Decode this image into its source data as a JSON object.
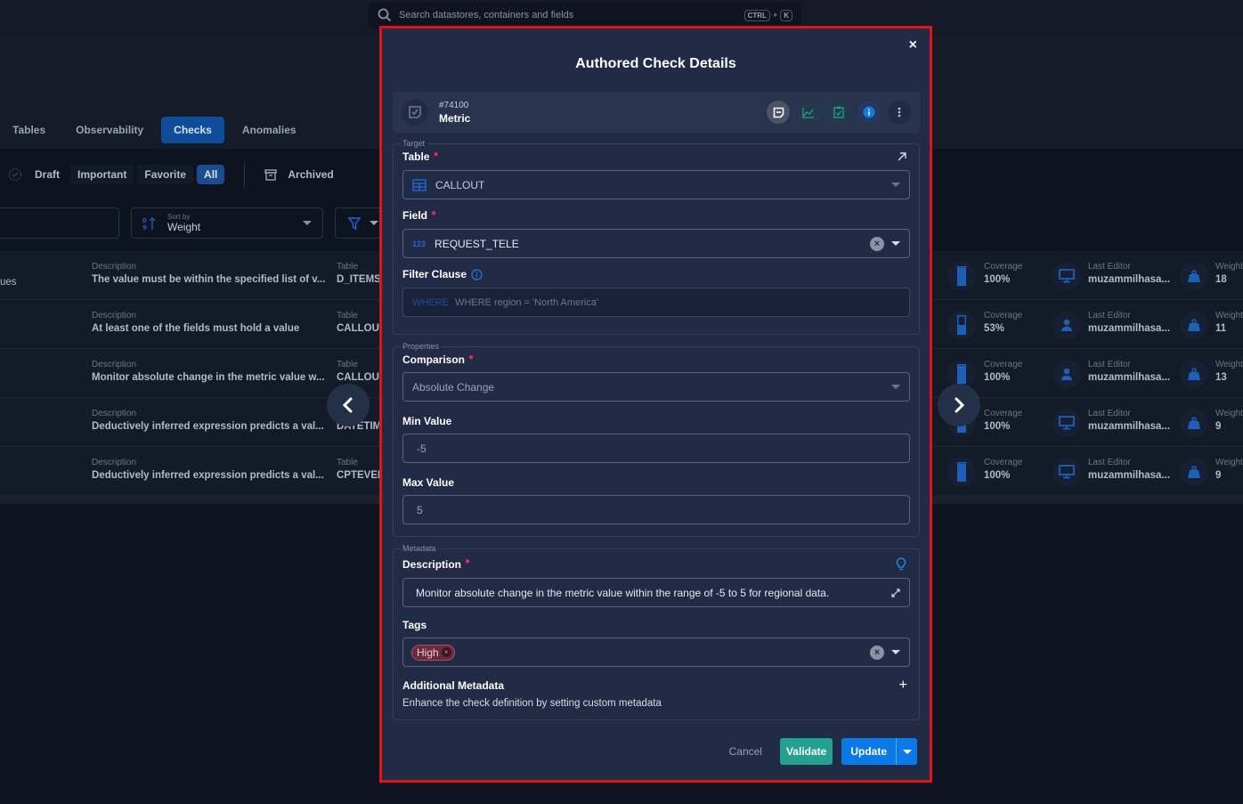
{
  "global_search": {
    "placeholder": "Search datastores, containers and fields",
    "shortcut_key1": "CTRL",
    "shortcut_plus": "+",
    "shortcut_key2": "K"
  },
  "tabs": [
    {
      "label": "Tables",
      "active": false
    },
    {
      "label": "Observability",
      "active": false
    },
    {
      "label": "Checks",
      "active": true
    },
    {
      "label": "Anomalies",
      "active": false
    }
  ],
  "filters": {
    "chips": [
      "Draft",
      "Important",
      "Favorite",
      "All"
    ],
    "active_chip": "All",
    "archived_label": "Archived"
  },
  "sort": {
    "label": "Sort by",
    "value": "Weight"
  },
  "list": {
    "partial_name": "ues",
    "rows": [
      {
        "desc_label": "Description",
        "description": "The value must be within the specified list of v...",
        "table_label": "Table",
        "table": "D_ITEMS",
        "coverage_label": "Coverage",
        "coverage": "100%",
        "editor_label": "Last Editor",
        "editor": "muzammilhasa...",
        "editor_icon": "monitor-icon",
        "weight_label": "Weight",
        "weight": "18"
      },
      {
        "desc_label": "Description",
        "description": "At least one of the fields must hold a value",
        "table_label": "Table",
        "table": "CALLOUT",
        "coverage_label": "Coverage",
        "coverage": "53%",
        "editor_label": "Last Editor",
        "editor": "muzammilhasa...",
        "editor_icon": "user-icon",
        "weight_label": "Weight",
        "weight": "11"
      },
      {
        "desc_label": "Description",
        "description": "Monitor absolute change in the metric value w...",
        "table_label": "Table",
        "table": "CALLOUT",
        "coverage_label": "Coverage",
        "coverage": "100%",
        "editor_label": "Last Editor",
        "editor": "muzammilhasa...",
        "editor_icon": "user-icon",
        "weight_label": "Weight",
        "weight": "13"
      },
      {
        "desc_label": "Description",
        "description": "Deductively inferred expression predicts a val...",
        "table_label": "Table",
        "table": "DATETIME",
        "coverage_label": "Coverage",
        "coverage": "100%",
        "editor_label": "Last Editor",
        "editor": "muzammilhasa...",
        "editor_icon": "monitor-icon",
        "weight_label": "Weight",
        "weight": "9"
      },
      {
        "desc_label": "Description",
        "description": "Deductively inferred expression predicts a val...",
        "table_label": "Table",
        "table": "CPTEVENTS",
        "coverage_label": "Coverage",
        "coverage": "100%",
        "editor_label": "Last Editor",
        "editor": "muzammilhasa...",
        "editor_icon": "monitor-icon",
        "weight_label": "Weight",
        "weight": "9"
      }
    ]
  },
  "modal": {
    "title": "Authored Check Details",
    "close": "×",
    "check": {
      "id": "#74100",
      "type": "Metric"
    },
    "target": {
      "legend": "Target",
      "table_label": "Table",
      "table_value": "CALLOUT",
      "field_label": "Field",
      "field_type_badge": "123",
      "field_value": "REQUEST_TELE",
      "filter_label": "Filter Clause",
      "filter_prefix": "WHERE",
      "filter_value": "WHERE region = 'North America'"
    },
    "properties": {
      "legend": "Properties",
      "comparison_label": "Comparison",
      "comparison_value": "Absolute Change",
      "min_label": "Min Value",
      "min_value": "-5",
      "max_label": "Max Value",
      "max_value": "5"
    },
    "metadata": {
      "legend": "Metadata",
      "description_label": "Description",
      "description_value": "Monitor absolute change in the metric value within the range of -5 to 5 for regional data.",
      "tags_label": "Tags",
      "tags": [
        "High"
      ],
      "additional_label": "Additional Metadata",
      "additional_hint": "Enhance the check definition by setting custom metadata",
      "add": "+"
    },
    "footer": {
      "cancel": "Cancel",
      "validate": "Validate",
      "update": "Update"
    }
  },
  "colors": {
    "accent": "#0b7ae6",
    "validate": "#23a08f",
    "required": "#e8265e",
    "highlight_border": "#e01414",
    "tag_high": "#6a2b3c"
  }
}
